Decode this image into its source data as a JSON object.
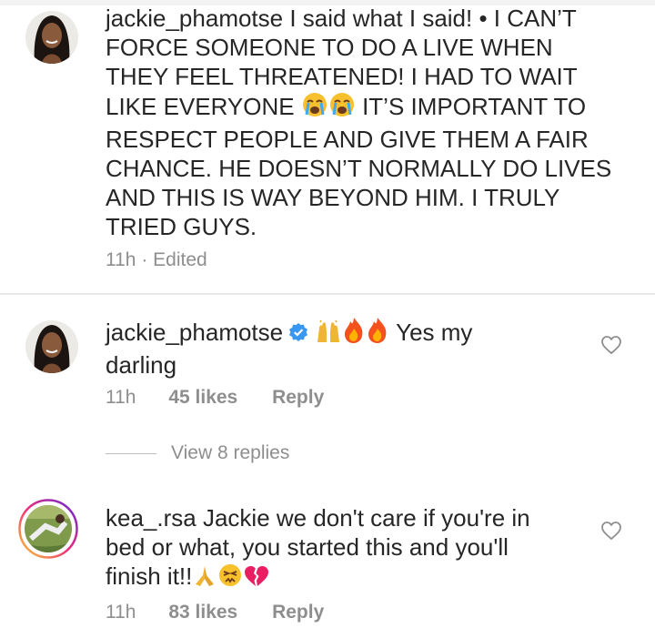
{
  "comments": [
    {
      "username": "jackie_phamotse",
      "text_lines": [
        "I said what I said! • I CAN’T",
        "FORCE SOMEONE TO DO A LIVE WHEN",
        "THEY FEEL THREATENED! I HAD TO WAIT",
        "LIKE EVERYONE",
        "IT’S IMPORTANT TO",
        "RESPECT PEOPLE AND GIVE THEM A FAIR",
        "CHANCE. HE DOESN’T NORMALLY DO LIVES",
        "AND THIS IS WAY BEYOND HIM. I TRULY",
        "TRIED GUYS."
      ],
      "time": "11h",
      "edited": "· Edited"
    },
    {
      "username": "jackie_phamotse",
      "text_after_emoji": "Yes my",
      "text_line2": "darling",
      "time": "11h",
      "likes": "45 likes",
      "reply": "Reply",
      "view_replies": "View 8 replies"
    },
    {
      "username": "kea_.rsa",
      "text_lines": [
        "Jackie we don't care if you're in",
        "bed or what, you started this and you'll",
        "finish it!!"
      ],
      "time": "11h",
      "likes": "83 likes",
      "reply": "Reply"
    }
  ],
  "icons": {
    "verified": "verified-badge-icon",
    "heart": "heart-outline-icon",
    "emoji": [
      "crying-face-emoji",
      "raised-hands-emoji",
      "fire-emoji",
      "pray-emoji",
      "persevering-face-emoji",
      "broken-heart-emoji"
    ]
  },
  "colors": {
    "text": "#262626",
    "meta": "#8e8e8e",
    "verified": "#3897f0"
  }
}
